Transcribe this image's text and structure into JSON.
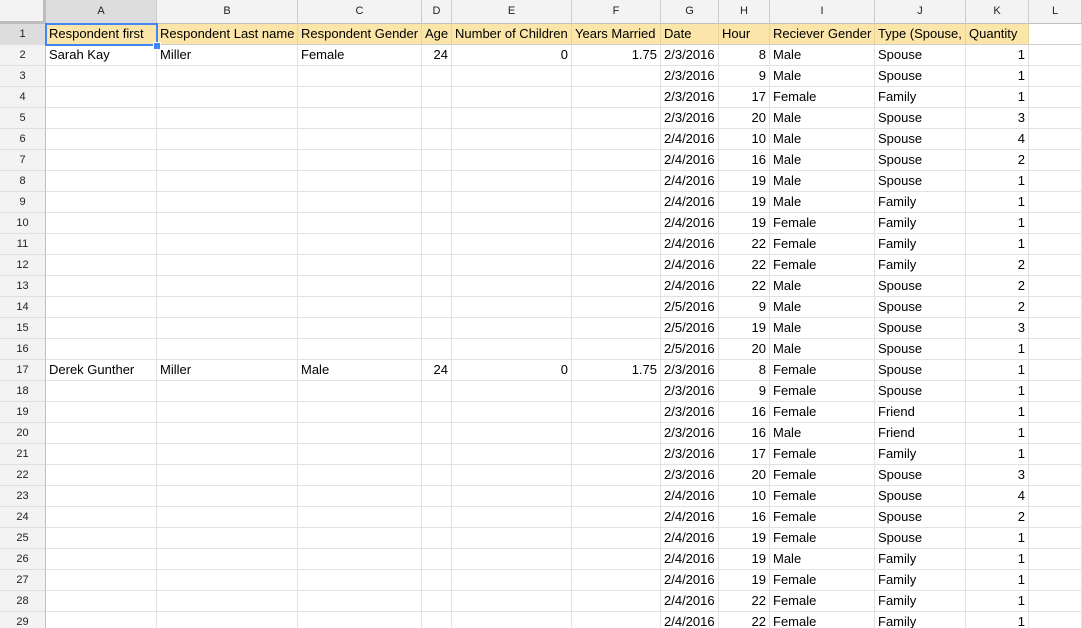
{
  "sheet": {
    "columns": [
      {
        "id": "A",
        "active": true
      },
      {
        "id": "B"
      },
      {
        "id": "C"
      },
      {
        "id": "D"
      },
      {
        "id": "E"
      },
      {
        "id": "F"
      },
      {
        "id": "G"
      },
      {
        "id": "H"
      },
      {
        "id": "I"
      },
      {
        "id": "J"
      },
      {
        "id": "K"
      },
      {
        "id": "L"
      }
    ],
    "selected_cell": "A1",
    "header_row": {
      "row_number": "1",
      "cells": [
        "Respondent first",
        "Respondent Last name",
        "Respondent Gender",
        "Age",
        "Number of Children",
        "Years Married",
        "Date",
        "Hour",
        "Reciever Gender",
        "Type (Spouse,",
        "Quantity",
        ""
      ]
    },
    "rows": [
      {
        "n": "2",
        "a": "Sarah Kay",
        "b": "Miller",
        "c": "Female",
        "d": "24",
        "e": "0",
        "f": "1.75",
        "g": "2/3/2016",
        "h": "8",
        "i": "Male",
        "j": "Spouse",
        "k": "1"
      },
      {
        "n": "3",
        "a": "",
        "b": "",
        "c": "",
        "d": "",
        "e": "",
        "f": "",
        "g": "2/3/2016",
        "h": "9",
        "i": "Male",
        "j": "Spouse",
        "k": "1"
      },
      {
        "n": "4",
        "a": "",
        "b": "",
        "c": "",
        "d": "",
        "e": "",
        "f": "",
        "g": "2/3/2016",
        "h": "17",
        "i": "Female",
        "j": "Family",
        "k": "1"
      },
      {
        "n": "5",
        "a": "",
        "b": "",
        "c": "",
        "d": "",
        "e": "",
        "f": "",
        "g": "2/3/2016",
        "h": "20",
        "i": "Male",
        "j": "Spouse",
        "k": "3"
      },
      {
        "n": "6",
        "a": "",
        "b": "",
        "c": "",
        "d": "",
        "e": "",
        "f": "",
        "g": "2/4/2016",
        "h": "10",
        "i": "Male",
        "j": "Spouse",
        "k": "4"
      },
      {
        "n": "7",
        "a": "",
        "b": "",
        "c": "",
        "d": "",
        "e": "",
        "f": "",
        "g": "2/4/2016",
        "h": "16",
        "i": "Male",
        "j": "Spouse",
        "k": "2"
      },
      {
        "n": "8",
        "a": "",
        "b": "",
        "c": "",
        "d": "",
        "e": "",
        "f": "",
        "g": "2/4/2016",
        "h": "19",
        "i": "Male",
        "j": "Spouse",
        "k": "1"
      },
      {
        "n": "9",
        "a": "",
        "b": "",
        "c": "",
        "d": "",
        "e": "",
        "f": "",
        "g": "2/4/2016",
        "h": "19",
        "i": "Male",
        "j": "Family",
        "k": "1"
      },
      {
        "n": "10",
        "a": "",
        "b": "",
        "c": "",
        "d": "",
        "e": "",
        "f": "",
        "g": "2/4/2016",
        "h": "19",
        "i": "Female",
        "j": "Family",
        "k": "1"
      },
      {
        "n": "11",
        "a": "",
        "b": "",
        "c": "",
        "d": "",
        "e": "",
        "f": "",
        "g": "2/4/2016",
        "h": "22",
        "i": "Female",
        "j": "Family",
        "k": "1"
      },
      {
        "n": "12",
        "a": "",
        "b": "",
        "c": "",
        "d": "",
        "e": "",
        "f": "",
        "g": "2/4/2016",
        "h": "22",
        "i": "Female",
        "j": "Family",
        "k": "2"
      },
      {
        "n": "13",
        "a": "",
        "b": "",
        "c": "",
        "d": "",
        "e": "",
        "f": "",
        "g": "2/4/2016",
        "h": "22",
        "i": "Male",
        "j": "Spouse",
        "k": "2"
      },
      {
        "n": "14",
        "a": "",
        "b": "",
        "c": "",
        "d": "",
        "e": "",
        "f": "",
        "g": "2/5/2016",
        "h": "9",
        "i": "Male",
        "j": "Spouse",
        "k": "2"
      },
      {
        "n": "15",
        "a": "",
        "b": "",
        "c": "",
        "d": "",
        "e": "",
        "f": "",
        "g": "2/5/2016",
        "h": "19",
        "i": "Male",
        "j": "Spouse",
        "k": "3"
      },
      {
        "n": "16",
        "a": "",
        "b": "",
        "c": "",
        "d": "",
        "e": "",
        "f": "",
        "g": "2/5/2016",
        "h": "20",
        "i": "Male",
        "j": "Spouse",
        "k": "1"
      },
      {
        "n": "17",
        "a": "Derek Gunther",
        "b": "Miller",
        "c": "Male",
        "d": "24",
        "e": "0",
        "f": "1.75",
        "g": "2/3/2016",
        "h": "8",
        "i": "Female",
        "j": "Spouse",
        "k": "1"
      },
      {
        "n": "18",
        "a": "",
        "b": "",
        "c": "",
        "d": "",
        "e": "",
        "f": "",
        "g": "2/3/2016",
        "h": "9",
        "i": "Female",
        "j": "Spouse",
        "k": "1"
      },
      {
        "n": "19",
        "a": "",
        "b": "",
        "c": "",
        "d": "",
        "e": "",
        "f": "",
        "g": "2/3/2016",
        "h": "16",
        "i": "Female",
        "j": "Friend",
        "k": "1"
      },
      {
        "n": "20",
        "a": "",
        "b": "",
        "c": "",
        "d": "",
        "e": "",
        "f": "",
        "g": "2/3/2016",
        "h": "16",
        "i": "Male",
        "j": "Friend",
        "k": "1"
      },
      {
        "n": "21",
        "a": "",
        "b": "",
        "c": "",
        "d": "",
        "e": "",
        "f": "",
        "g": "2/3/2016",
        "h": "17",
        "i": "Female",
        "j": "Family",
        "k": "1"
      },
      {
        "n": "22",
        "a": "",
        "b": "",
        "c": "",
        "d": "",
        "e": "",
        "f": "",
        "g": "2/3/2016",
        "h": "20",
        "i": "Female",
        "j": "Spouse",
        "k": "3"
      },
      {
        "n": "23",
        "a": "",
        "b": "",
        "c": "",
        "d": "",
        "e": "",
        "f": "",
        "g": "2/4/2016",
        "h": "10",
        "i": "Female",
        "j": "Spouse",
        "k": "4"
      },
      {
        "n": "24",
        "a": "",
        "b": "",
        "c": "",
        "d": "",
        "e": "",
        "f": "",
        "g": "2/4/2016",
        "h": "16",
        "i": "Female",
        "j": "Spouse",
        "k": "2"
      },
      {
        "n": "25",
        "a": "",
        "b": "",
        "c": "",
        "d": "",
        "e": "",
        "f": "",
        "g": "2/4/2016",
        "h": "19",
        "i": "Female",
        "j": "Spouse",
        "k": "1"
      },
      {
        "n": "26",
        "a": "",
        "b": "",
        "c": "",
        "d": "",
        "e": "",
        "f": "",
        "g": "2/4/2016",
        "h": "19",
        "i": "Male",
        "j": "Family",
        "k": "1"
      },
      {
        "n": "27",
        "a": "",
        "b": "",
        "c": "",
        "d": "",
        "e": "",
        "f": "",
        "g": "2/4/2016",
        "h": "19",
        "i": "Female",
        "j": "Family",
        "k": "1"
      },
      {
        "n": "28",
        "a": "",
        "b": "",
        "c": "",
        "d": "",
        "e": "",
        "f": "",
        "g": "2/4/2016",
        "h": "22",
        "i": "Female",
        "j": "Family",
        "k": "1"
      },
      {
        "n": "29",
        "a": "",
        "b": "",
        "c": "",
        "d": "",
        "e": "",
        "f": "",
        "g": "2/4/2016",
        "h": "22",
        "i": "Female",
        "j": "Family",
        "k": "1"
      }
    ],
    "colors": {
      "header_fill": "#fce5a8",
      "selection_blue": "#4285f4",
      "grid_line": "#e2e2e2",
      "row_col_header_bg": "#f3f3f3"
    }
  }
}
